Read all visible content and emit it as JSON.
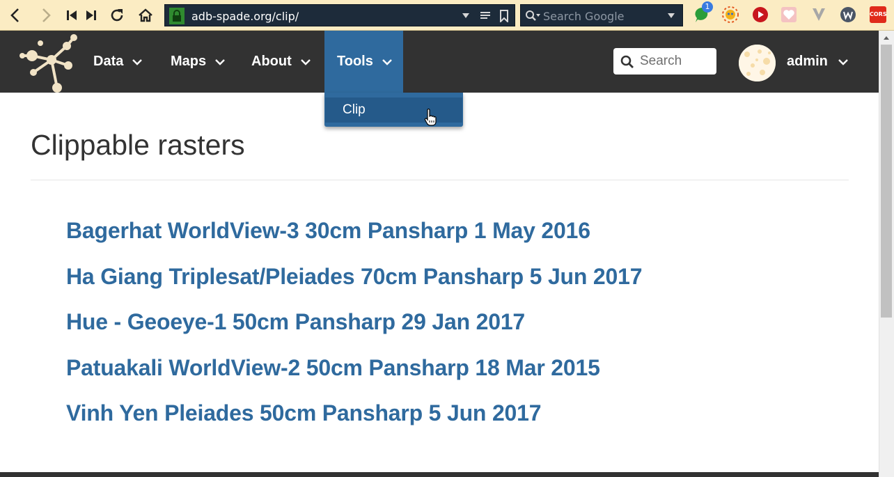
{
  "browser": {
    "url": "adb-spade.org/clip/",
    "search_placeholder": "Search Google",
    "notification_count": "1",
    "cors_label": "CORS"
  },
  "nav": {
    "items": [
      {
        "label": "Data"
      },
      {
        "label": "Maps"
      },
      {
        "label": "About"
      },
      {
        "label": "Tools"
      }
    ],
    "search_placeholder": "Search",
    "user": "admin",
    "active_color": "#2f6a9e",
    "bar_color": "#323232"
  },
  "dropdown": {
    "items": [
      {
        "label": "Clip"
      }
    ]
  },
  "page": {
    "title": "Clippable rasters",
    "link_color": "#2f6a9e",
    "rasters": [
      {
        "label": "Bagerhat WorldView-3 30cm Pansharp 1 May 2016"
      },
      {
        "label": "Ha Giang Triplesat/Pleiades 70cm Pansharp 5 Jun 2017"
      },
      {
        "label": "Hue - Geoeye-1 50cm Pansharp 29 Jan 2017"
      },
      {
        "label": "Patuakali WorldView-2 50cm Pansharp 18 Mar 2015"
      },
      {
        "label": "Vinh Yen Pleiades 50cm Pansharp 5 Jun 2017"
      }
    ]
  }
}
